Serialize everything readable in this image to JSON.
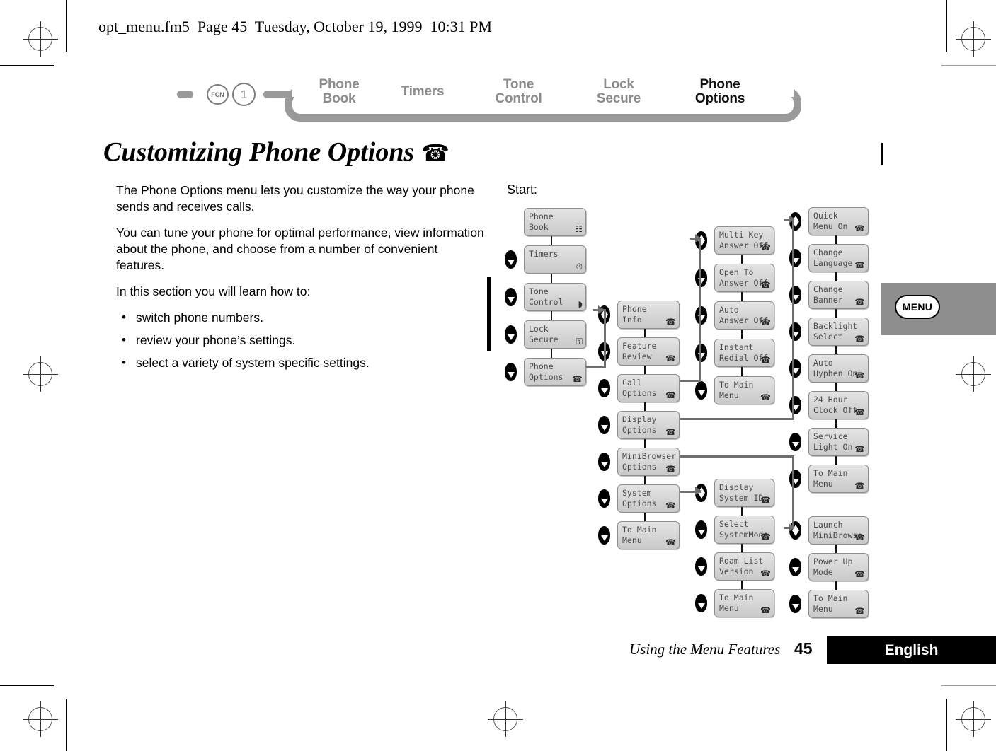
{
  "page": {
    "file_header": "opt_menu.fm5  Page 45  Tuesday, October 19, 1999  10:31 PM",
    "title": "Customizing Phone Options",
    "title_icon": "phone-icon",
    "start_label": "Start:",
    "menu_tab_label": "MENU",
    "footer_text": "Using the Menu Features",
    "footer_page": "45",
    "footer_language": "English"
  },
  "breadcrumb": {
    "key_fcn": "FCN",
    "key_one": "1",
    "items": [
      {
        "line1": "Phone",
        "line2": "Book",
        "current": false
      },
      {
        "line1": "Timers",
        "line2": "",
        "current": false
      },
      {
        "line1": "Tone",
        "line2": "Control",
        "current": false
      },
      {
        "line1": "Lock",
        "line2": "Secure",
        "current": false
      },
      {
        "line1": "Phone",
        "line2": "Options",
        "current": true
      }
    ]
  },
  "body": {
    "paragraphs": [
      "The Phone Options menu lets you customize the way your phone sends and receives calls.",
      "You can tune your phone for optimal performance, view information about the phone, and choose from a number of convenient features.",
      "In this section you will learn how to:"
    ],
    "bullets": [
      "switch phone numbers.",
      "review your phone’s settings.",
      "select a variety of system specific settings."
    ]
  },
  "flow": {
    "main_menu": [
      {
        "l1": "Phone",
        "l2": "Book",
        "glyph": "☷",
        "icon": "book-icon",
        "key": "none"
      },
      {
        "l1": "Timers",
        "l2": "",
        "glyph": "⏱",
        "icon": "timer-icon",
        "key": "down"
      },
      {
        "l1": "Tone",
        "l2": "Control",
        "glyph": "◗",
        "icon": "bell-icon",
        "key": "down"
      },
      {
        "l1": "Lock",
        "l2": "Secure",
        "glyph": "⚿",
        "icon": "lock-icon",
        "key": "down"
      },
      {
        "l1": "Phone",
        "l2": "Options",
        "glyph": "☎",
        "icon": "phone-icon",
        "key": "down"
      }
    ],
    "phone_options": [
      {
        "l1": "Phone",
        "l2": "Info",
        "glyph": "☎",
        "icon": "phone-icon",
        "key": "updown"
      },
      {
        "l1": "Feature",
        "l2": "Review",
        "glyph": "☎",
        "icon": "phone-icon",
        "key": "down"
      },
      {
        "l1": "Call",
        "l2": "Options",
        "glyph": "☎",
        "icon": "phone-icon",
        "key": "down"
      },
      {
        "l1": "Display",
        "l2": "Options",
        "glyph": "☎",
        "icon": "phone-icon",
        "key": "down"
      },
      {
        "l1": "MiniBrowser",
        "l2": "Options",
        "glyph": "☎",
        "icon": "phone-icon",
        "key": "down"
      },
      {
        "l1": "System",
        "l2": "Options",
        "glyph": "☎",
        "icon": "phone-icon",
        "key": "down"
      },
      {
        "l1": "To Main",
        "l2": "Menu",
        "glyph": "☎",
        "icon": "phone-icon",
        "key": "down"
      }
    ],
    "call_options": [
      {
        "l1": "Multi Key",
        "l2": "Answer Off",
        "glyph": "☎",
        "icon": "phone-icon",
        "key": "updown"
      },
      {
        "l1": "Open To",
        "l2": "Answer Off",
        "glyph": "☎",
        "icon": "phone-icon",
        "key": "down"
      },
      {
        "l1": "Auto",
        "l2": "Answer Off",
        "glyph": "☎",
        "icon": "phone-icon",
        "key": "down"
      },
      {
        "l1": "Instant",
        "l2": "Redial Off",
        "glyph": "☎",
        "icon": "phone-icon",
        "key": "down"
      },
      {
        "l1": "To Main",
        "l2": "Menu",
        "glyph": "☎",
        "icon": "phone-icon",
        "key": "down"
      }
    ],
    "system_options": [
      {
        "l1": "Display",
        "l2": "System ID",
        "glyph": "☎",
        "icon": "phone-icon",
        "key": "updown"
      },
      {
        "l1": "Select",
        "l2": "SystemMode",
        "glyph": "☎",
        "icon": "phone-icon",
        "key": "down"
      },
      {
        "l1": "Roam List",
        "l2": "Version",
        "glyph": "☎",
        "icon": "phone-icon",
        "key": "down"
      },
      {
        "l1": "To Main",
        "l2": "Menu",
        "glyph": "☎",
        "icon": "phone-icon",
        "key": "down"
      }
    ],
    "display_options": [
      {
        "l1": "Quick",
        "l2": "Menu On",
        "glyph": "☎",
        "icon": "phone-icon",
        "key": "updown"
      },
      {
        "l1": "Change",
        "l2": "Language",
        "glyph": "☎",
        "icon": "phone-icon",
        "key": "down"
      },
      {
        "l1": "Change",
        "l2": "Banner",
        "glyph": "☎",
        "icon": "phone-icon",
        "key": "down"
      },
      {
        "l1": "Backlight",
        "l2": "Select",
        "glyph": "☎",
        "icon": "phone-icon",
        "key": "down"
      },
      {
        "l1": "Auto",
        "l2": "Hyphen On",
        "glyph": "☎",
        "icon": "phone-icon",
        "key": "down"
      },
      {
        "l1": "24 Hour",
        "l2": "Clock Off",
        "glyph": "☎",
        "icon": "phone-icon",
        "key": "down"
      },
      {
        "l1": "Service",
        "l2": "Light On",
        "glyph": "☎",
        "icon": "phone-icon",
        "key": "down"
      },
      {
        "l1": "To Main",
        "l2": "Menu",
        "glyph": "☎",
        "icon": "phone-icon",
        "key": "down"
      }
    ],
    "minibrowser_options": [
      {
        "l1": "Launch",
        "l2": "MiniBrowse",
        "glyph": "☎",
        "icon": "phone-icon",
        "key": "updown"
      },
      {
        "l1": "Power Up",
        "l2": "Mode",
        "glyph": "☎",
        "icon": "phone-icon",
        "key": "down"
      },
      {
        "l1": "To Main",
        "l2": "Menu",
        "glyph": "☎",
        "icon": "phone-icon",
        "key": "down"
      }
    ]
  }
}
